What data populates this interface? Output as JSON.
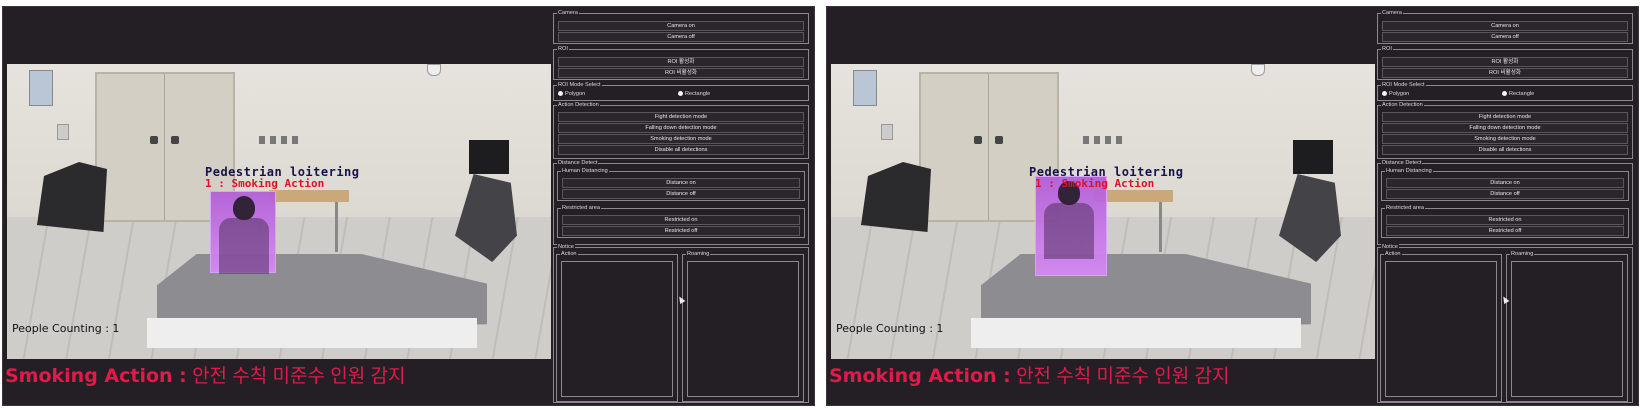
{
  "windows": [
    {
      "video": {
        "label_pedestrian": "Pedestrian loitering",
        "label_action": "1 : Smoking Action",
        "people_counting": "People Counting : 1"
      },
      "alert": {
        "key": "Smoking Action :",
        "message": "안전 수칙 미준수 인원 감지"
      }
    },
    {
      "video": {
        "label_pedestrian": "Pedestrian loitering",
        "label_action": "1 : Smoking Action",
        "people_counting": "People Counting : 1"
      },
      "alert": {
        "key": "Smoking Action :",
        "message": "안전 수칙 미준수 인원 감지"
      }
    }
  ],
  "panel": {
    "camera": {
      "title": "Camera",
      "on": "Camera on",
      "off": "Camera off"
    },
    "roi": {
      "title": "ROI",
      "activate": "ROI 활성화",
      "deactivate": "ROI 비활성화"
    },
    "roi_mode": {
      "title": "ROI Mode Select",
      "polygon": "Polygon",
      "rectangle": "Rectangle"
    },
    "action": {
      "title": "Action Detection",
      "fight": "Fight detection mode",
      "falling": "Falling down detection mode",
      "smoking": "Smoking detection mode",
      "disable": "Disable all detections"
    },
    "distance": {
      "title": "Distance Detect",
      "human_title": "Human Distancing",
      "distance_on": "Distance on",
      "distance_off": "Distance off",
      "restricted_title": "Restricted area",
      "restricted_on": "Restricted on",
      "restricted_off": "Restricted off"
    },
    "notice": {
      "title": "Notice",
      "action": "Action",
      "roaming": "Roaming"
    }
  },
  "colors": {
    "background": "#231f24",
    "alert": "#e21a4c",
    "overlay": "#c77ae8"
  }
}
